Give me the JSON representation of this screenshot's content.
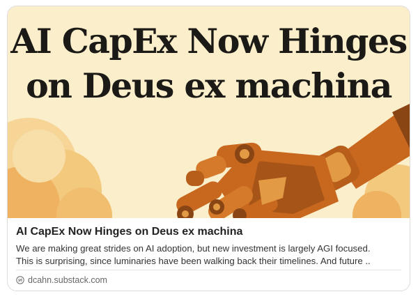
{
  "card": {
    "hero_title_lines": [
      "AI CapEx Now Hinges",
      "on Deus ex machina"
    ],
    "title": "AI CapEx Now Hinges on Deus ex machina",
    "description_lines": [
      "We are making great strides on AI adoption, but new investment is largely AGI focused.",
      "This is surprising, since luminaries have been walking back their timelines. And future .."
    ],
    "source": "dcahn.substack.com",
    "source_icon": "link-icon",
    "hero_image": "robot-hand-illustration"
  },
  "colors": {
    "hero_background": "#fbeecb",
    "cloud": "#f1be6f",
    "robot_hand": "#c8681f",
    "title_text": "#1c1a17"
  }
}
